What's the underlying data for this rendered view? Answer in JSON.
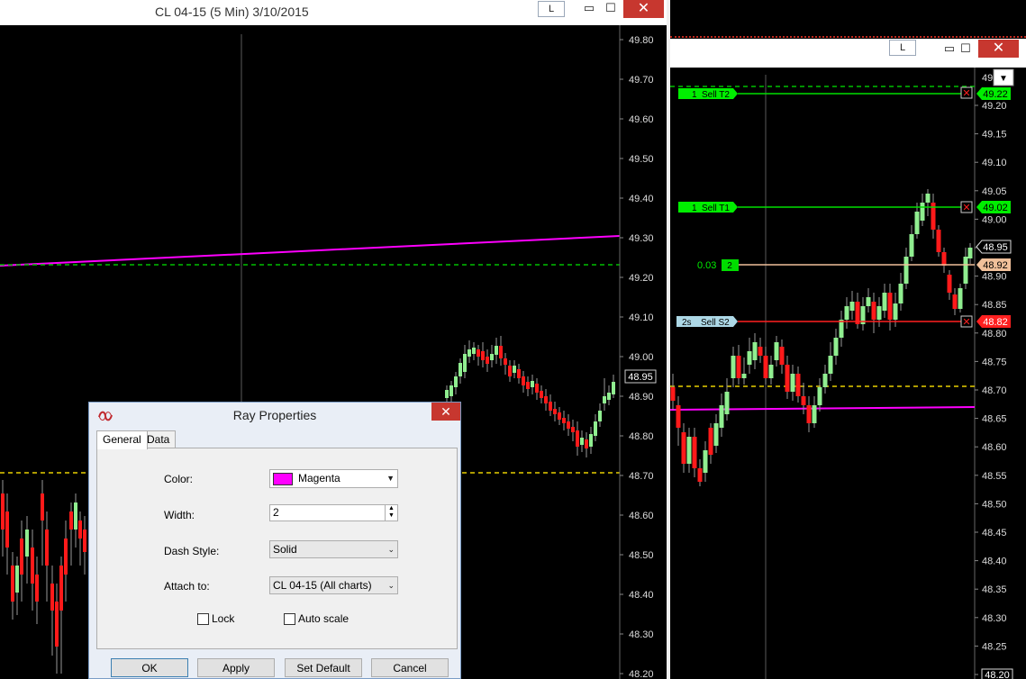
{
  "left_window": {
    "title": "CL 04-15 (5 Min)  3/10/2015",
    "lock_label": "L",
    "minimize": "▭",
    "maximize": "☐",
    "close": "✕",
    "price_axis": [
      "49.80",
      "49.70",
      "49.60",
      "49.50",
      "49.40",
      "49.30",
      "49.20",
      "49.10",
      "49.00",
      "48.90",
      "48.80",
      "48.70",
      "48.60",
      "48.50",
      "48.40",
      "48.30",
      "48.20"
    ],
    "last_price": "48.95"
  },
  "right_window": {
    "lock_label": "L",
    "minimize": "▭",
    "maximize": "☐",
    "close": "✕",
    "dropdown": "▼",
    "price_axis": [
      "49.20",
      "49.15",
      "49.10",
      "49.05",
      "49.00",
      "48.95",
      "48.90",
      "48.85",
      "48.80",
      "48.75",
      "48.70",
      "48.65",
      "48.60",
      "48.55",
      "48.50",
      "48.45",
      "48.40",
      "48.35",
      "48.30",
      "48.25",
      "48.20"
    ],
    "axis_top_partial": "49.",
    "orders": {
      "sell_t2": {
        "qty": "1",
        "label": "Sell T2",
        "price": "49.22"
      },
      "sell_t1": {
        "qty": "1",
        "label": "Sell T1",
        "price": "49.02"
      },
      "position": {
        "pnl": "0.03",
        "qty": "2",
        "price": "48.92"
      },
      "sell_s2": {
        "qty": "2s",
        "label": "Sell S2",
        "price": "48.82"
      }
    },
    "last_price": "48.95",
    "bottom_partial": "48.20"
  },
  "dialog": {
    "title": "Ray Properties",
    "close": "✕",
    "tabs": [
      "General",
      "Data"
    ],
    "color_label": "Color:",
    "color_value": "Magenta",
    "color_hex": "#ff00ff",
    "width_label": "Width:",
    "width_value": "2",
    "dash_label": "Dash Style:",
    "dash_value": "Solid",
    "attach_label": "Attach to:",
    "attach_value": "CL 04-15 (All charts)",
    "lock_label": "Lock",
    "lock_checked": false,
    "autoscale_label": "Auto scale",
    "autoscale_checked": false,
    "buttons": [
      "OK",
      "Apply",
      "Set Default",
      "Cancel"
    ]
  }
}
